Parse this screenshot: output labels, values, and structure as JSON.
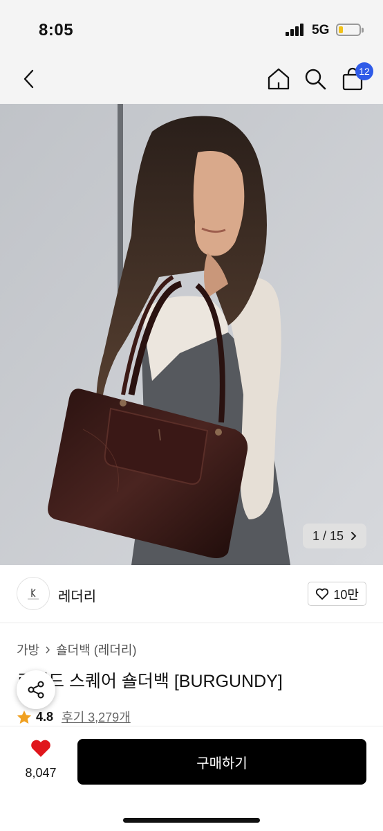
{
  "status_bar": {
    "time": "8:05",
    "network": "5G"
  },
  "nav": {
    "cart_count": "12"
  },
  "hero": {
    "image_counter": "1 / 15"
  },
  "brand": {
    "name": "레더리"
  },
  "like": {
    "count": "10만"
  },
  "breadcrumb": [
    "가방",
    "숄더백 (레더리)"
  ],
  "product": {
    "title": "로렌드 스퀘어 숄더백 [BURGUNDY]"
  },
  "rating": {
    "value": "4.8",
    "reviews": "후기 3,279개"
  },
  "bottom_bar": {
    "wish_count": "8,047",
    "buy_label": "구매하기"
  },
  "colors": {
    "accent_blue": "#2f5be8",
    "heart_red": "#e0161c",
    "star": "#f0a020",
    "bag": "#3a1a16"
  },
  "icons": [
    "back-arrow-icon",
    "home-icon",
    "search-icon",
    "cart-icon",
    "chevron-right-icon",
    "heart-outline-icon",
    "share-icon",
    "star-icon",
    "heart-filled-icon"
  ]
}
